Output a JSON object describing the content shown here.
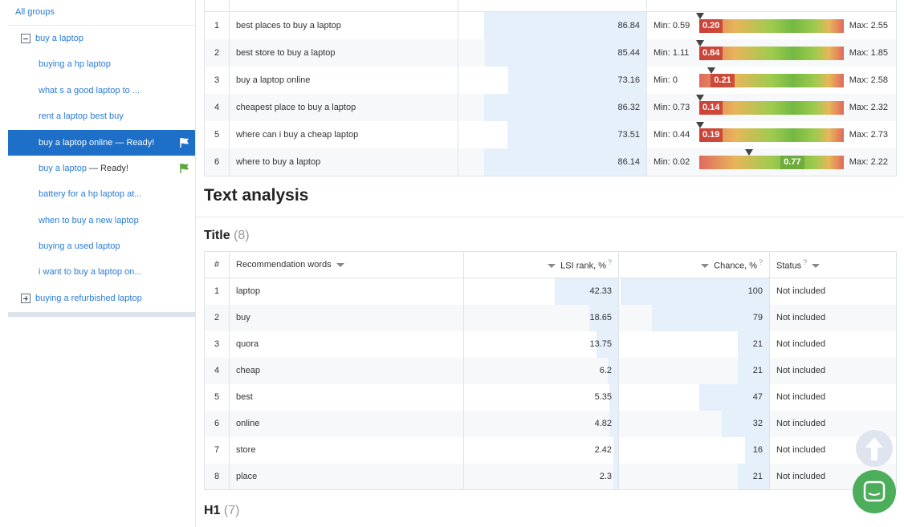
{
  "sidebar": {
    "all_groups": "All groups",
    "groups": [
      {
        "label": "buy a laptop"
      },
      {
        "label": "buying a refurbished laptop"
      }
    ],
    "children": [
      {
        "label": "buying a hp laptop"
      },
      {
        "label": "what s a good laptop to ..."
      },
      {
        "label": "rent a laptop best buy"
      },
      {
        "label": "buy a laptop online — Ready!"
      },
      {
        "label": "buy a laptop",
        "suffix": " — Ready!"
      },
      {
        "label": "battery for a hp laptop at..."
      },
      {
        "label": "when to buy a new laptop"
      },
      {
        "label": "buying a used laptop"
      },
      {
        "label": "i want to buy a laptop on..."
      }
    ],
    "colors": {
      "link": "#2b7bd6",
      "active_bg": "#1d6fc7",
      "flag_green": "#5aa83e"
    },
    "icons": [
      "flag-icon",
      "plus-icon",
      "minus-icon"
    ]
  },
  "keyword_table": {
    "rows": [
      {
        "n": "1",
        "keyword": "best places to buy a laptop",
        "value": "86.84",
        "min": "Min: 0.59",
        "val": "0.20",
        "max": "Max: 2.55",
        "pos": 0.0
      },
      {
        "n": "2",
        "keyword": "best store to buy a laptop",
        "value": "85.44",
        "min": "Min: 1.11",
        "val": "0.84",
        "max": "Max: 1.85",
        "pos": 0.0
      },
      {
        "n": "3",
        "keyword": "buy a laptop online",
        "value": "73.16",
        "min": "Min: 0",
        "val": "0.21",
        "max": "Max: 2.58",
        "pos": 0.08
      },
      {
        "n": "4",
        "keyword": "cheapest place to buy a laptop",
        "value": "86.32",
        "min": "Min: 0.73",
        "val": "0.14",
        "max": "Max: 2.32",
        "pos": 0.0
      },
      {
        "n": "5",
        "keyword": "where can i buy a cheap laptop",
        "value": "73.51",
        "min": "Min: 0.44",
        "val": "0.19",
        "max": "Max: 2.73",
        "pos": 0.0
      },
      {
        "n": "6",
        "keyword": "where to buy a laptop",
        "value": "86.14",
        "min": "Min: 0.02",
        "val": "0.77",
        "max": "Max: 2.22",
        "pos": 0.34
      }
    ]
  },
  "text_analysis": {
    "heading": "Text analysis",
    "title_section": {
      "label": "Title",
      "count": "(8)"
    },
    "h1_section": {
      "label": "H1",
      "count": "(7)"
    },
    "columns": {
      "num": "#",
      "words": "Recommendation words",
      "lsi": "LSI rank, %",
      "chance": "Chance, %",
      "status": "Status"
    },
    "help_mark": "?",
    "rows": [
      {
        "n": "1",
        "word": "laptop",
        "lsi": "42.33",
        "lsi_frac": 0.43,
        "chance": "100",
        "chance_frac": 1.0,
        "status": "Not included"
      },
      {
        "n": "2",
        "word": "buy",
        "lsi": "18.65",
        "lsi_frac": 0.19,
        "chance": "79",
        "chance_frac": 0.79,
        "status": "Not included"
      },
      {
        "n": "3",
        "word": "quora",
        "lsi": "13.75",
        "lsi_frac": 0.14,
        "chance": "21",
        "chance_frac": 0.21,
        "status": "Not included"
      },
      {
        "n": "4",
        "word": "cheap",
        "lsi": "6.2",
        "lsi_frac": 0.06,
        "chance": "21",
        "chance_frac": 0.21,
        "status": "Not included"
      },
      {
        "n": "5",
        "word": "best",
        "lsi": "5.35",
        "lsi_frac": 0.05,
        "chance": "47",
        "chance_frac": 0.47,
        "status": "Not included"
      },
      {
        "n": "6",
        "word": "online",
        "lsi": "4.82",
        "lsi_frac": 0.05,
        "chance": "32",
        "chance_frac": 0.32,
        "status": "Not included"
      },
      {
        "n": "7",
        "word": "store",
        "lsi": "2.42",
        "lsi_frac": 0.02,
        "chance": "16",
        "chance_frac": 0.16,
        "status": "Not included"
      },
      {
        "n": "8",
        "word": "place",
        "lsi": "2.3",
        "lsi_frac": 0.02,
        "chance": "21",
        "chance_frac": 0.21,
        "status": "Not included"
      }
    ]
  },
  "floating": {
    "scroll_top_icon": "arrow-up-icon",
    "chat_icon": "chat-icon"
  }
}
